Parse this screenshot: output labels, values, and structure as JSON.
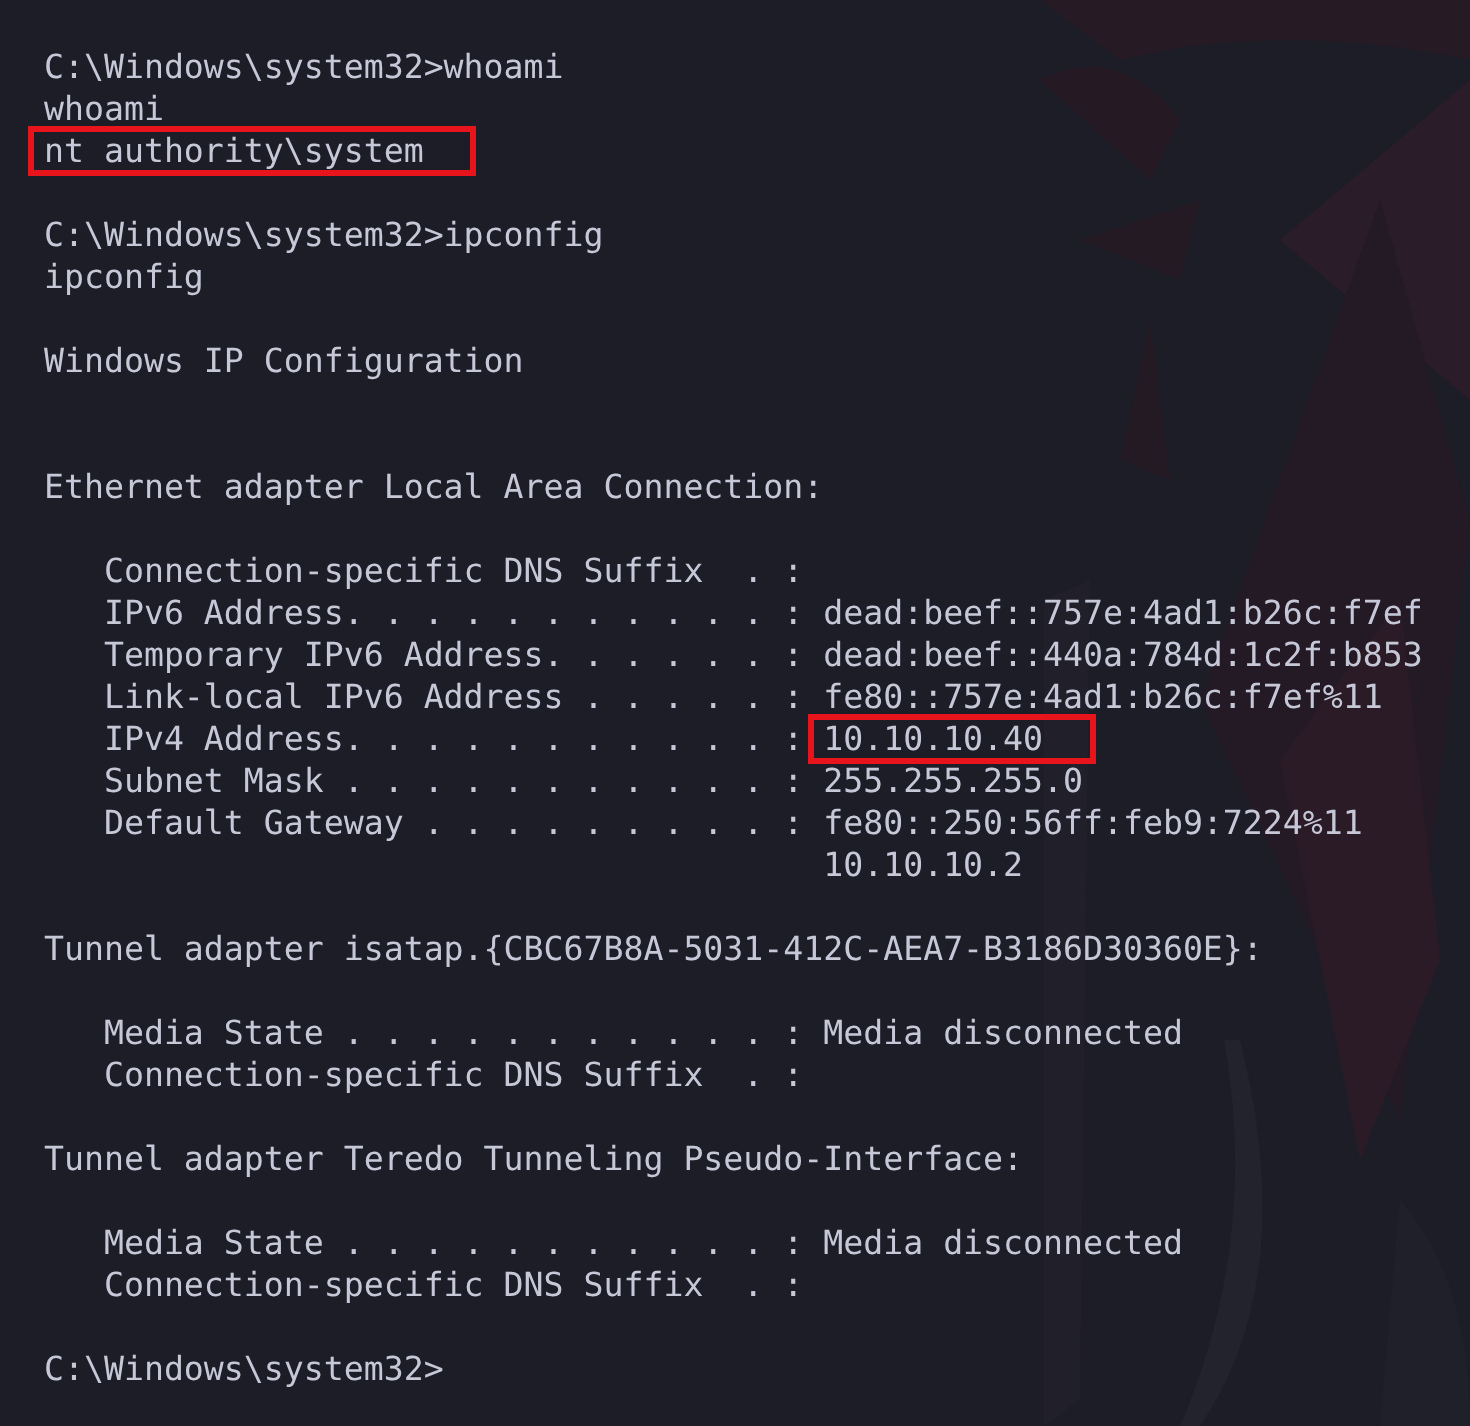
{
  "terminal": {
    "lines": [
      {
        "kind": "text",
        "parts": [
          {
            "text": "C:\\Windows\\system32>whoami",
            "highlighted": false
          }
        ]
      },
      {
        "kind": "text",
        "parts": [
          {
            "text": "whoami",
            "highlighted": false
          }
        ]
      },
      {
        "kind": "text",
        "parts": [
          {
            "text": "nt authority\\system",
            "highlighted": true
          }
        ]
      },
      {
        "kind": "blank"
      },
      {
        "kind": "text",
        "parts": [
          {
            "text": "C:\\Windows\\system32>ipconfig",
            "highlighted": false
          }
        ]
      },
      {
        "kind": "text",
        "parts": [
          {
            "text": "ipconfig",
            "highlighted": false
          }
        ]
      },
      {
        "kind": "blank"
      },
      {
        "kind": "text",
        "parts": [
          {
            "text": "Windows IP Configuration",
            "highlighted": false
          }
        ]
      },
      {
        "kind": "blank"
      },
      {
        "kind": "blank"
      },
      {
        "kind": "text",
        "parts": [
          {
            "text": "Ethernet adapter Local Area Connection:",
            "highlighted": false
          }
        ]
      },
      {
        "kind": "blank"
      },
      {
        "kind": "text",
        "parts": [
          {
            "text": "   Connection-specific DNS Suffix  . :",
            "highlighted": false
          }
        ]
      },
      {
        "kind": "text",
        "parts": [
          {
            "text": "   IPv6 Address. . . . . . . . . . . : dead:beef::757e:4ad1:b26c:f7ef",
            "highlighted": false
          }
        ]
      },
      {
        "kind": "text",
        "parts": [
          {
            "text": "   Temporary IPv6 Address. . . . . . : dead:beef::440a:784d:1c2f:b853",
            "highlighted": false
          }
        ]
      },
      {
        "kind": "text",
        "parts": [
          {
            "text": "   Link-local IPv6 Address . . . . . : fe80::757e:4ad1:b26c:f7ef%11",
            "highlighted": false
          }
        ]
      },
      {
        "kind": "text",
        "parts": [
          {
            "text": "   IPv4 Address. . . . . . . . . . . : ",
            "highlighted": false
          },
          {
            "text": "10.10.10.40",
            "highlighted": true
          }
        ]
      },
      {
        "kind": "text",
        "parts": [
          {
            "text": "   Subnet Mask . . . . . . . . . . . : 255.255.255.0",
            "highlighted": false
          }
        ]
      },
      {
        "kind": "text",
        "parts": [
          {
            "text": "   Default Gateway . . . . . . . . . : fe80::250:56ff:feb9:7224%11",
            "highlighted": false
          }
        ]
      },
      {
        "kind": "text",
        "parts": [
          {
            "text": "                                       10.10.10.2",
            "highlighted": false
          }
        ]
      },
      {
        "kind": "blank"
      },
      {
        "kind": "text",
        "parts": [
          {
            "text": "Tunnel adapter isatap.{CBC67B8A-5031-412C-AEA7-B3186D30360E}:",
            "highlighted": false
          }
        ]
      },
      {
        "kind": "blank"
      },
      {
        "kind": "text",
        "parts": [
          {
            "text": "   Media State . . . . . . . . . . . : Media disconnected",
            "highlighted": false
          }
        ]
      },
      {
        "kind": "text",
        "parts": [
          {
            "text": "   Connection-specific DNS Suffix  . :",
            "highlighted": false
          }
        ]
      },
      {
        "kind": "blank"
      },
      {
        "kind": "text",
        "parts": [
          {
            "text": "Tunnel adapter Teredo Tunneling Pseudo-Interface:",
            "highlighted": false
          }
        ]
      },
      {
        "kind": "blank"
      },
      {
        "kind": "text",
        "parts": [
          {
            "text": "   Media State . . . . . . . . . . . : Media disconnected",
            "highlighted": false
          }
        ]
      },
      {
        "kind": "text",
        "parts": [
          {
            "text": "   Connection-specific DNS Suffix  . :",
            "highlighted": false
          }
        ]
      },
      {
        "kind": "blank"
      },
      {
        "kind": "text",
        "parts": [
          {
            "text": "C:\\Windows\\system32>",
            "highlighted": false
          }
        ]
      }
    ]
  }
}
